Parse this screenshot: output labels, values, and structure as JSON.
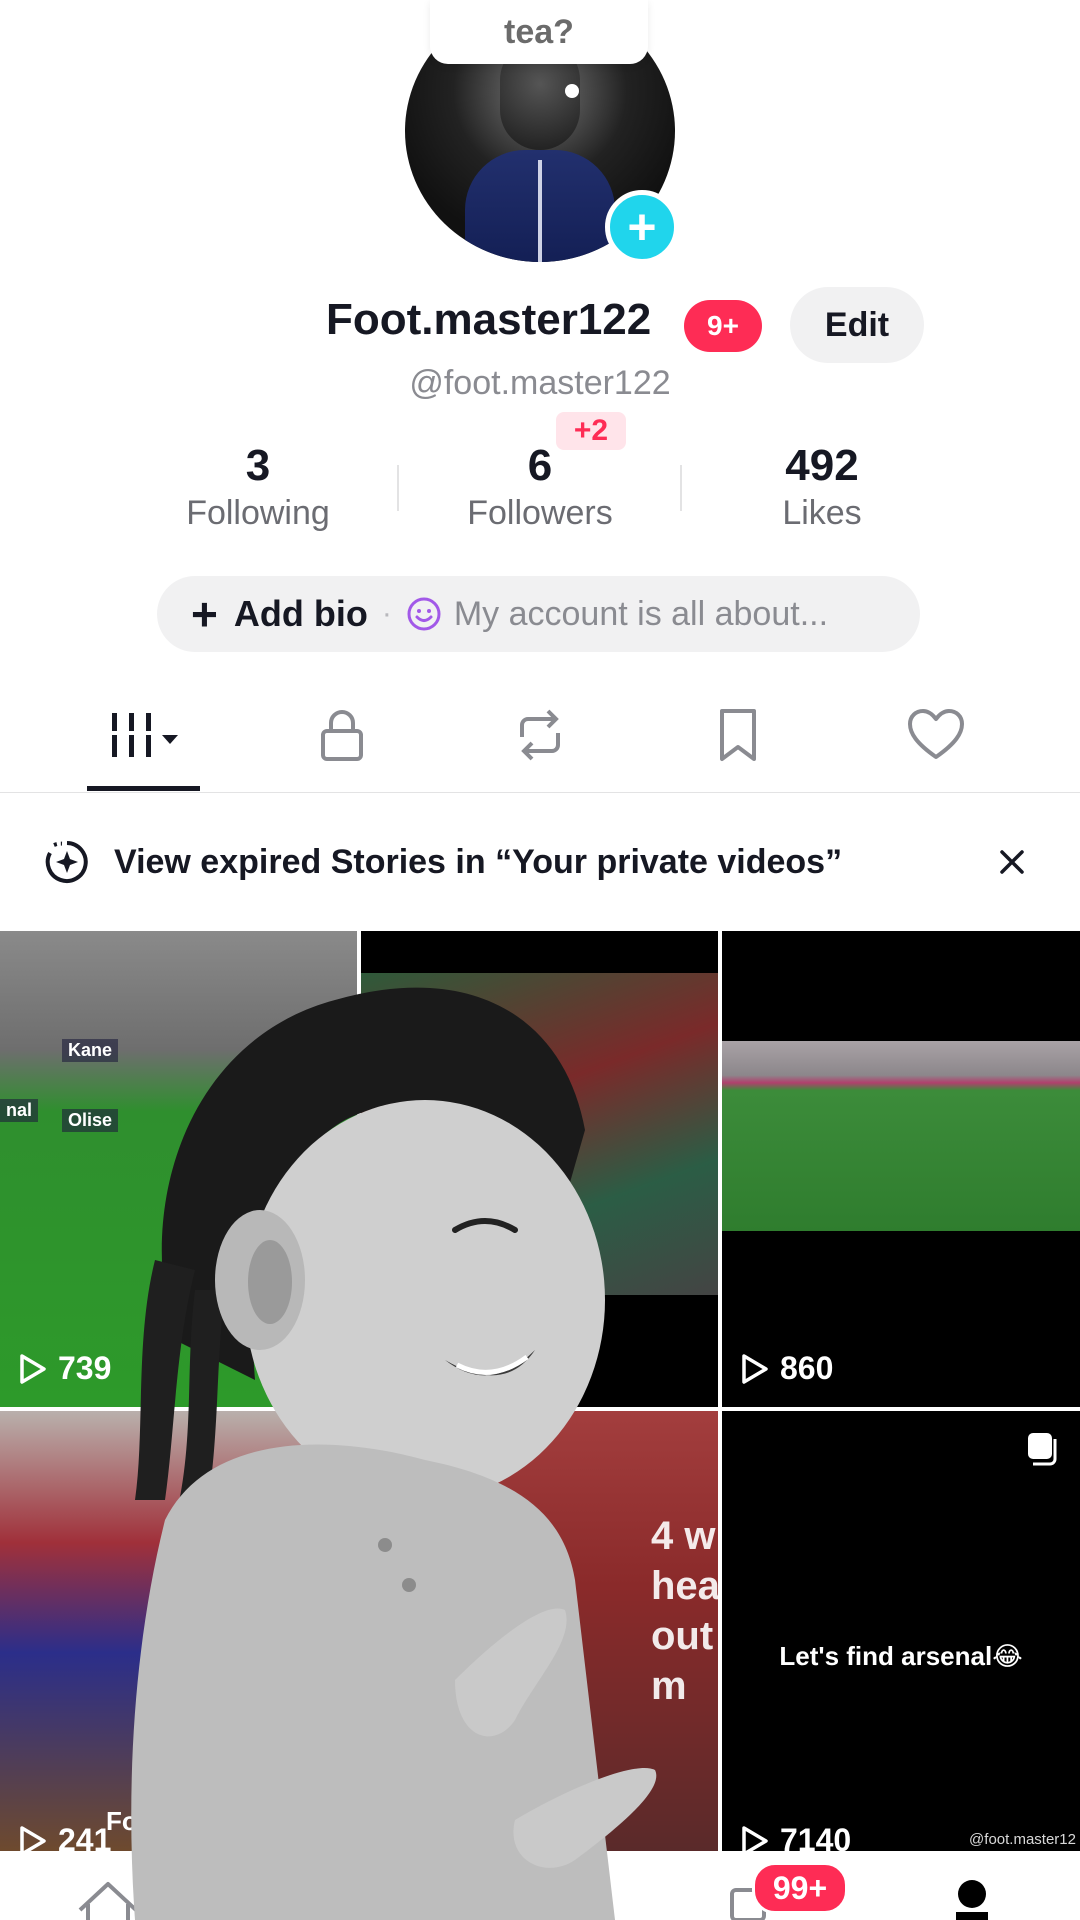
{
  "header": {
    "note_bubble": "tea?",
    "username": "Foot.master122",
    "notification_badge": "9+",
    "edit_label": "Edit",
    "handle": "@foot.master122"
  },
  "stats": {
    "following": {
      "value": "3",
      "label": "Following"
    },
    "followers": {
      "value": "6",
      "label": "Followers",
      "delta": "+2"
    },
    "likes": {
      "value": "492",
      "label": "Likes"
    }
  },
  "bio": {
    "add_label": "Add bio",
    "separator": "·",
    "placeholder": "My account is all about..."
  },
  "tabs": [
    {
      "icon": "grid-icon",
      "active": true
    },
    {
      "icon": "lock-icon"
    },
    {
      "icon": "repost-icon"
    },
    {
      "icon": "bookmark-icon"
    },
    {
      "icon": "heart-icon"
    }
  ],
  "stories_banner": {
    "text": "View expired Stories in “Your private videos”"
  },
  "videos": [
    {
      "views": "739",
      "labels": [
        "Kane",
        "Olise",
        "nal"
      ]
    },
    {
      "views": ""
    },
    {
      "views": "860"
    },
    {
      "views": "241",
      "overlay_text": "Foo"
    },
    {
      "views": "",
      "overlay_text": "4 w\nhea\nout\nm"
    },
    {
      "views": "7140",
      "caption": "Let's find arsenal😂",
      "watermark": "@foot.master12"
    }
  ],
  "bottom_nav": {
    "inbox_badge": "99+"
  },
  "colors": {
    "accent_red": "#fe2c55",
    "accent_cyan": "#20d5ec",
    "text_primary": "#161823",
    "text_secondary": "#8a8b91"
  }
}
